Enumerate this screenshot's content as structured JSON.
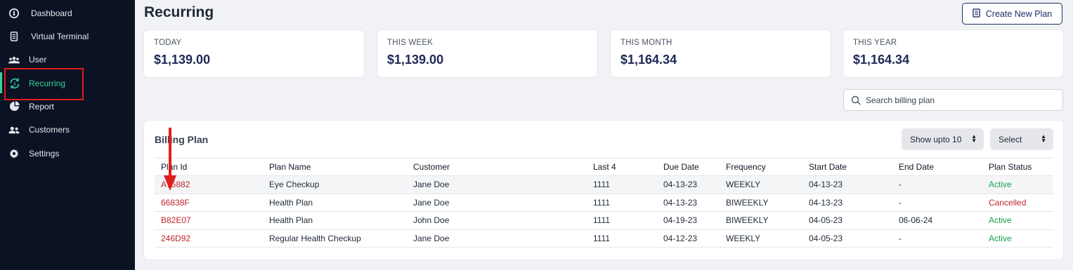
{
  "sidebar": {
    "items": [
      {
        "label": "Dashboard",
        "icon": "dashboard-icon"
      },
      {
        "label": "Virtual Terminal",
        "icon": "terminal-icon"
      },
      {
        "label": "User",
        "icon": "users-icon"
      },
      {
        "label": "Recurring",
        "icon": "recurring-icon",
        "active": true
      },
      {
        "label": "Report",
        "icon": "pie-chart-icon"
      },
      {
        "label": "Customers",
        "icon": "customers-icon"
      },
      {
        "label": "Settings",
        "icon": "gear-icon"
      }
    ]
  },
  "header": {
    "title": "Recurring",
    "create_button": "Create New Plan"
  },
  "stats": [
    {
      "label": "TODAY",
      "value": "$1,139.00"
    },
    {
      "label": "THIS WEEK",
      "value": "$1,139.00"
    },
    {
      "label": "THIS MONTH",
      "value": "$1,164.34"
    },
    {
      "label": "THIS YEAR",
      "value": "$1,164.34"
    }
  ],
  "search": {
    "placeholder": "Search billing plan",
    "value": ""
  },
  "billing": {
    "title": "Billing Plan",
    "show_select": "Show upto 10",
    "filter_select": "Select",
    "columns": [
      "Plan Id",
      "Plan Name",
      "Customer",
      "Last 4",
      "Due Date",
      "Frequency",
      "Start Date",
      "End Date",
      "Plan Status"
    ],
    "rows": [
      [
        "A75882",
        "Eye Checkup",
        "Jane Doe",
        "1111",
        "04-13-23",
        "WEEKLY",
        "04-13-23",
        "-",
        "Active"
      ],
      [
        "66838F",
        "Health Plan",
        "Jane Doe",
        "1111",
        "04-13-23",
        "BIWEEKLY",
        "04-13-23",
        "-",
        "Cancelled"
      ],
      [
        "B82E07",
        "Health Plan",
        "John Doe",
        "1111",
        "04-19-23",
        "BIWEEKLY",
        "04-05-23",
        "06-06-24",
        "Active"
      ],
      [
        "246D92",
        "Regular Health Checkup",
        "Jane Doe",
        "1111",
        "04-12-23",
        "WEEKLY",
        "04-05-23",
        "-",
        "Active"
      ]
    ]
  },
  "colors": {
    "sidebar_bg": "#0b1224",
    "accent_green": "#34d399",
    "brand_navy": "#1e2f6b",
    "link_red": "#c0262d",
    "active_green": "#16a34a",
    "annotation_red": "#e11d1d"
  }
}
